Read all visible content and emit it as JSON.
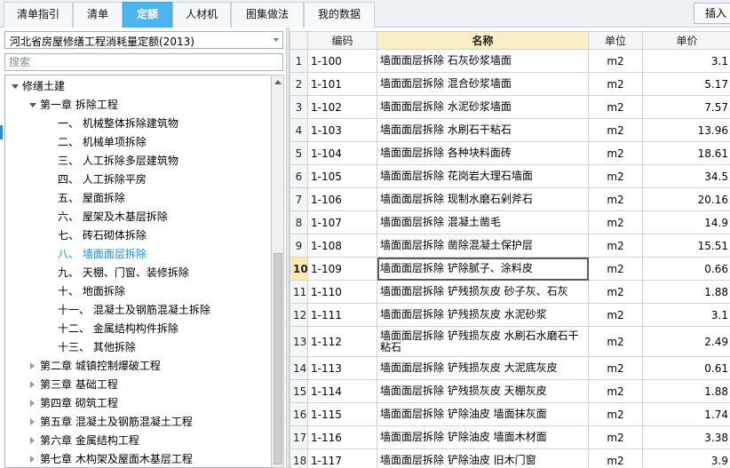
{
  "tabs": [
    {
      "label": "清单指引",
      "active": false
    },
    {
      "label": "清单",
      "active": false
    },
    {
      "label": "定额",
      "active": true
    },
    {
      "label": "人材机",
      "active": false
    },
    {
      "label": "图集做法",
      "active": false
    },
    {
      "label": "我的数据",
      "active": false
    }
  ],
  "insert_button": "插入",
  "library_selector": {
    "value": "河北省房屋修缮工程消耗量定额(2013)"
  },
  "search": {
    "placeholder": "搜索"
  },
  "tree": [
    {
      "label": "修缮土建",
      "toggle": "expanded",
      "level": 0
    },
    {
      "label": "第一章  拆除工程",
      "toggle": "expanded",
      "level": 1
    },
    {
      "label": "一、  机械整体拆除建筑物",
      "toggle": "none",
      "level": 2
    },
    {
      "label": "二、  机械单项拆除",
      "toggle": "none",
      "level": 2
    },
    {
      "label": "三、  人工拆除多层建筑物",
      "toggle": "none",
      "level": 2
    },
    {
      "label": "四、  人工拆除平房",
      "toggle": "none",
      "level": 2
    },
    {
      "label": "五、  屋面拆除",
      "toggle": "none",
      "level": 2
    },
    {
      "label": "六、  屋架及木基层拆除",
      "toggle": "none",
      "level": 2
    },
    {
      "label": "七、  砖石砌体拆除",
      "toggle": "none",
      "level": 2
    },
    {
      "label": "八、  墙面面层拆除",
      "toggle": "none",
      "level": 2,
      "selected": true
    },
    {
      "label": "九、  天棚、门窗、装修拆除",
      "toggle": "none",
      "level": 2
    },
    {
      "label": "十、  地面拆除",
      "toggle": "none",
      "level": 2
    },
    {
      "label": "十一、  混凝土及钢筋混凝土拆除",
      "toggle": "none",
      "level": 2
    },
    {
      "label": "十二、  金属结构构件拆除",
      "toggle": "none",
      "level": 2
    },
    {
      "label": "十三、  其他拆除",
      "toggle": "none",
      "level": 2
    },
    {
      "label": "第二章  城镇控制爆破工程",
      "toggle": "collapsed",
      "level": 1
    },
    {
      "label": "第三章  基础工程",
      "toggle": "collapsed",
      "level": 1
    },
    {
      "label": "第四章  砌筑工程",
      "toggle": "collapsed",
      "level": 1
    },
    {
      "label": "第五章  混凝土及钢筋混凝土工程",
      "toggle": "collapsed",
      "level": 1
    },
    {
      "label": "第六章  金属结构工程",
      "toggle": "collapsed",
      "level": 1
    },
    {
      "label": "第七章  木构架及屋面木基层工程",
      "toggle": "collapsed",
      "level": 1
    }
  ],
  "grid": {
    "columns": [
      "",
      "编码",
      "名称",
      "单位",
      "单价"
    ],
    "current_row": 10,
    "rows": [
      {
        "n": "1",
        "code": "1-100",
        "name": "墙面面层拆除  石灰砂浆墙面",
        "unit": "m2",
        "price": "3.1"
      },
      {
        "n": "2",
        "code": "1-101",
        "name": "墙面面层拆除  混合砂浆墙面",
        "unit": "m2",
        "price": "5.17"
      },
      {
        "n": "3",
        "code": "1-102",
        "name": "墙面面层拆除  水泥砂浆墙面",
        "unit": "m2",
        "price": "7.57"
      },
      {
        "n": "4",
        "code": "1-103",
        "name": "墙面面层拆除  水刷石干粘石",
        "unit": "m2",
        "price": "13.96"
      },
      {
        "n": "5",
        "code": "1-104",
        "name": "墙面面层拆除  各种块料面砖",
        "unit": "m2",
        "price": "18.61"
      },
      {
        "n": "6",
        "code": "1-105",
        "name": "墙面面层拆除  花岗岩大理石墙面",
        "unit": "m2",
        "price": "34.5"
      },
      {
        "n": "7",
        "code": "1-106",
        "name": "墙面面层拆除  现制水磨石剁斧石",
        "unit": "m2",
        "price": "20.16"
      },
      {
        "n": "8",
        "code": "1-107",
        "name": "墙面面层拆除  混凝土凿毛",
        "unit": "m2",
        "price": "14.9"
      },
      {
        "n": "9",
        "code": "1-108",
        "name": "墙面面层拆除  凿除混凝土保护层",
        "unit": "m2",
        "price": "15.51"
      },
      {
        "n": "10",
        "code": "1-109",
        "name": "墙面面层拆除  铲除腻子、涂料皮",
        "unit": "m2",
        "price": "0.66"
      },
      {
        "n": "11",
        "code": "1-110",
        "name": "墙面面层拆除  铲残损灰皮  砂子灰、石灰",
        "unit": "m2",
        "price": "1.88"
      },
      {
        "n": "12",
        "code": "1-111",
        "name": "墙面面层拆除  铲残损灰皮  水泥砂浆",
        "unit": "m2",
        "price": "3.1"
      },
      {
        "n": "13",
        "code": "1-112",
        "name": "墙面面层拆除  铲残损灰皮  水刷石水磨石干粘石",
        "unit": "m2",
        "price": "2.49"
      },
      {
        "n": "14",
        "code": "1-113",
        "name": "墙面面层拆除  铲残损灰皮  大泥底灰皮",
        "unit": "m2",
        "price": "0.61"
      },
      {
        "n": "15",
        "code": "1-114",
        "name": "墙面面层拆除  铲残损灰皮  天棚灰皮",
        "unit": "m2",
        "price": "1.88"
      },
      {
        "n": "16",
        "code": "1-115",
        "name": "墙面面层拆除  铲除油皮  墙面抹灰面",
        "unit": "m2",
        "price": "1.74"
      },
      {
        "n": "17",
        "code": "1-116",
        "name": "墙面面层拆除  铲除油皮  墙面木材面",
        "unit": "m2",
        "price": "3.38"
      },
      {
        "n": "18",
        "code": "1-117",
        "name": "墙面面层拆除  铲除油皮  旧木门窗",
        "unit": "m2",
        "price": "3.9"
      }
    ]
  }
}
